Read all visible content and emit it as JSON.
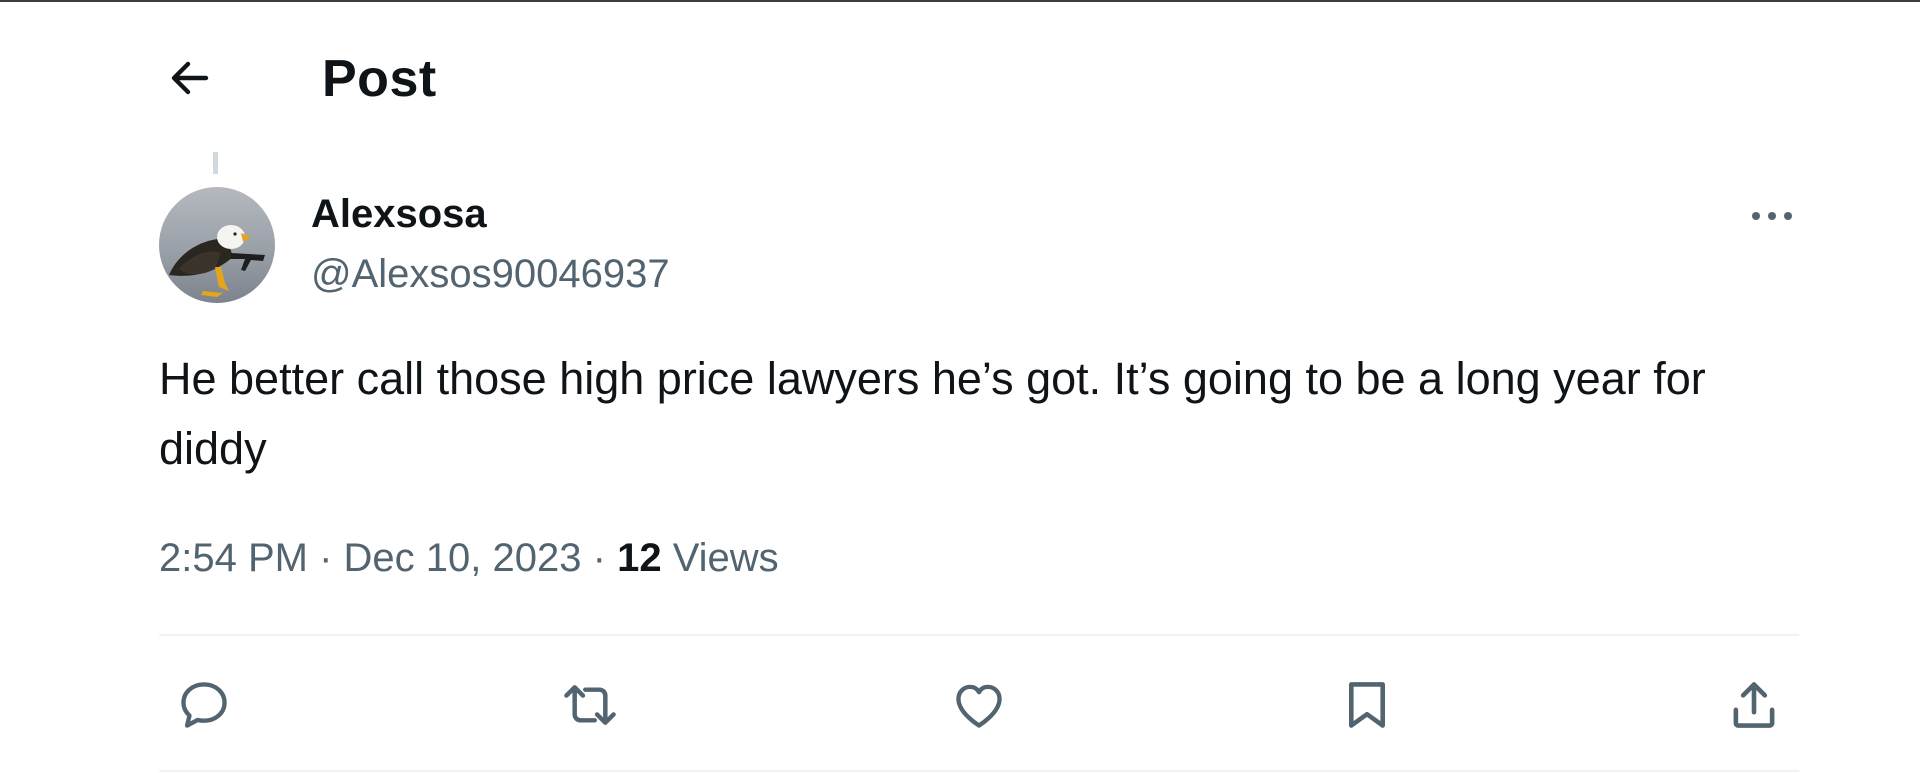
{
  "header": {
    "title": "Post",
    "back_icon": "arrow-left-icon"
  },
  "post": {
    "author": {
      "display_name": "Alexsosa",
      "handle": "@Alexsos90046937",
      "avatar": "bald-eagle-avatar"
    },
    "more_icon": "more-horizontal-icon",
    "text": "He better call those high price lawyers he’s got. It’s going to be a long year for diddy",
    "time": "2:54 PM",
    "date": "Dec 10, 2023",
    "separator": "·",
    "views_count": "12",
    "views_label": "Views"
  },
  "actions": {
    "reply_icon": "reply-icon",
    "repost_icon": "repost-icon",
    "like_icon": "like-heart-icon",
    "bookmark_icon": "bookmark-icon",
    "share_icon": "share-icon"
  },
  "colors": {
    "text_primary": "#0f1419",
    "text_secondary": "#536471",
    "divider": "#eff3f4",
    "icon": "#536471"
  }
}
